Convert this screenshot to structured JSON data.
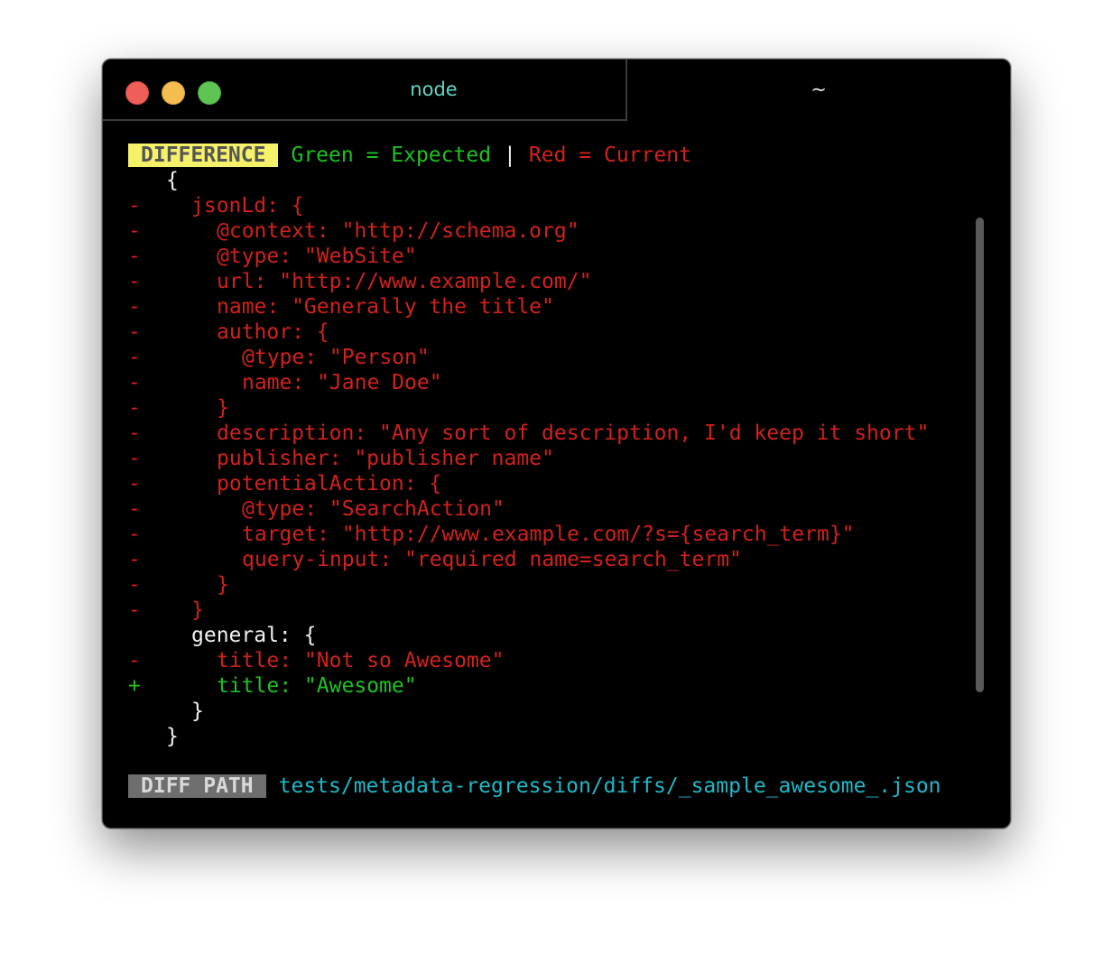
{
  "window": {
    "tabs": [
      {
        "label": "node",
        "active": true
      },
      {
        "label": "~",
        "active": false
      }
    ]
  },
  "header": {
    "badge": "DIFFERENCE",
    "expected_label": "Green = Expected",
    "separator": "|",
    "current_label": "Red = Current"
  },
  "diff": {
    "lines": [
      {
        "marker": " ",
        "indent": 0,
        "text": "{",
        "kind": "same"
      },
      {
        "marker": "-",
        "indent": 1,
        "text": "jsonLd: {",
        "kind": "removed"
      },
      {
        "marker": "-",
        "indent": 2,
        "text": "@context: \"http://schema.org\"",
        "kind": "removed"
      },
      {
        "marker": "-",
        "indent": 2,
        "text": "@type: \"WebSite\"",
        "kind": "removed"
      },
      {
        "marker": "-",
        "indent": 2,
        "text": "url: \"http://www.example.com/\"",
        "kind": "removed"
      },
      {
        "marker": "-",
        "indent": 2,
        "text": "name: \"Generally the title\"",
        "kind": "removed"
      },
      {
        "marker": "-",
        "indent": 2,
        "text": "author: {",
        "kind": "removed"
      },
      {
        "marker": "-",
        "indent": 3,
        "text": "@type: \"Person\"",
        "kind": "removed"
      },
      {
        "marker": "-",
        "indent": 3,
        "text": "name: \"Jane Doe\"",
        "kind": "removed"
      },
      {
        "marker": "-",
        "indent": 2,
        "text": "}",
        "kind": "removed"
      },
      {
        "marker": "-",
        "indent": 2,
        "text": "description: \"Any sort of description, I'd keep it short\"",
        "kind": "removed"
      },
      {
        "marker": "-",
        "indent": 2,
        "text": "publisher: \"publisher name\"",
        "kind": "removed"
      },
      {
        "marker": "-",
        "indent": 2,
        "text": "potentialAction: {",
        "kind": "removed"
      },
      {
        "marker": "-",
        "indent": 3,
        "text": "@type: \"SearchAction\"",
        "kind": "removed"
      },
      {
        "marker": "-",
        "indent": 3,
        "text": "target: \"http://www.example.com/?s={search_term}\"",
        "kind": "removed"
      },
      {
        "marker": "-",
        "indent": 3,
        "text": "query-input: \"required name=search_term\"",
        "kind": "removed"
      },
      {
        "marker": "-",
        "indent": 2,
        "text": "}",
        "kind": "removed"
      },
      {
        "marker": "-",
        "indent": 1,
        "text": "}",
        "kind": "removed"
      },
      {
        "marker": " ",
        "indent": 1,
        "text": "general: {",
        "kind": "same"
      },
      {
        "marker": "-",
        "indent": 2,
        "text": "title: \"Not so Awesome\"",
        "kind": "removed"
      },
      {
        "marker": "+",
        "indent": 2,
        "text": "title: \"Awesome\"",
        "kind": "added"
      },
      {
        "marker": " ",
        "indent": 1,
        "text": "}",
        "kind": "same"
      },
      {
        "marker": " ",
        "indent": 0,
        "text": "}",
        "kind": "same"
      }
    ]
  },
  "footer": {
    "badge": "DIFF PATH",
    "path": "tests/metadata-regression/diffs/_sample_awesome_.json"
  },
  "colors": {
    "added": "#1ec124",
    "removed": "#d0221c",
    "same": "#f2f2f2",
    "path": "#1fb8c9",
    "badge_diff_bg": "#f5f26a",
    "badge_path_bg": "#6e6e6e"
  }
}
